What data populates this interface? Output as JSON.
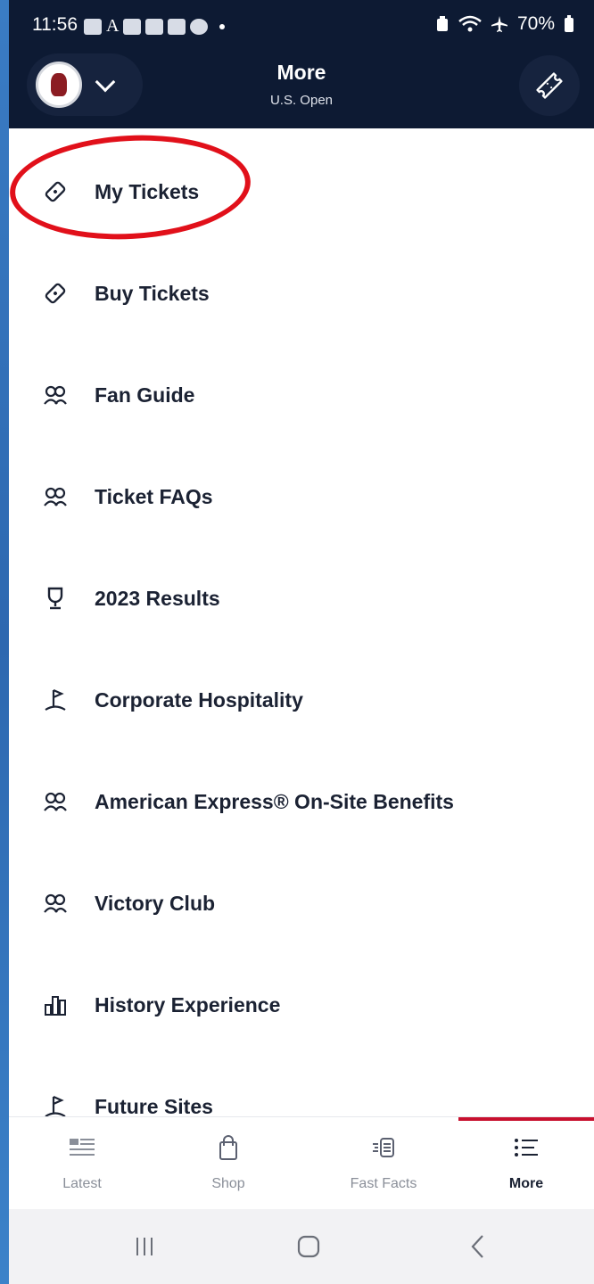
{
  "status_bar": {
    "time": "11:56",
    "notif_letter": "A",
    "battery": "70%"
  },
  "header": {
    "title": "More",
    "subtitle": "U.S. Open"
  },
  "menu": {
    "items": [
      {
        "label": "My Tickets",
        "icon": "ticket-icon"
      },
      {
        "label": "Buy Tickets",
        "icon": "ticket-icon"
      },
      {
        "label": "Fan Guide",
        "icon": "people-icon"
      },
      {
        "label": "Ticket FAQs",
        "icon": "people-icon"
      },
      {
        "label": "2023 Results",
        "icon": "trophy-icon"
      },
      {
        "label": "Corporate Hospitality",
        "icon": "golf-flag-icon"
      },
      {
        "label": "American Express® On-Site Benefits",
        "icon": "people-icon"
      },
      {
        "label": "Victory Club",
        "icon": "people-icon"
      },
      {
        "label": "History Experience",
        "icon": "bar-chart-icon"
      },
      {
        "label": "Future Sites",
        "icon": "golf-flag-icon"
      }
    ]
  },
  "tabs": [
    {
      "label": "Latest",
      "icon": "news-icon",
      "active": false
    },
    {
      "label": "Shop",
      "icon": "shopping-bag-icon",
      "active": false
    },
    {
      "label": "Fast Facts",
      "icon": "fast-facts-icon",
      "active": false
    },
    {
      "label": "More",
      "icon": "list-icon",
      "active": true
    }
  ],
  "colors": {
    "header_bg": "#0d1a33",
    "accent_red": "#c8102e",
    "annotation_red": "#e1101a",
    "text_dark": "#1b2233"
  }
}
